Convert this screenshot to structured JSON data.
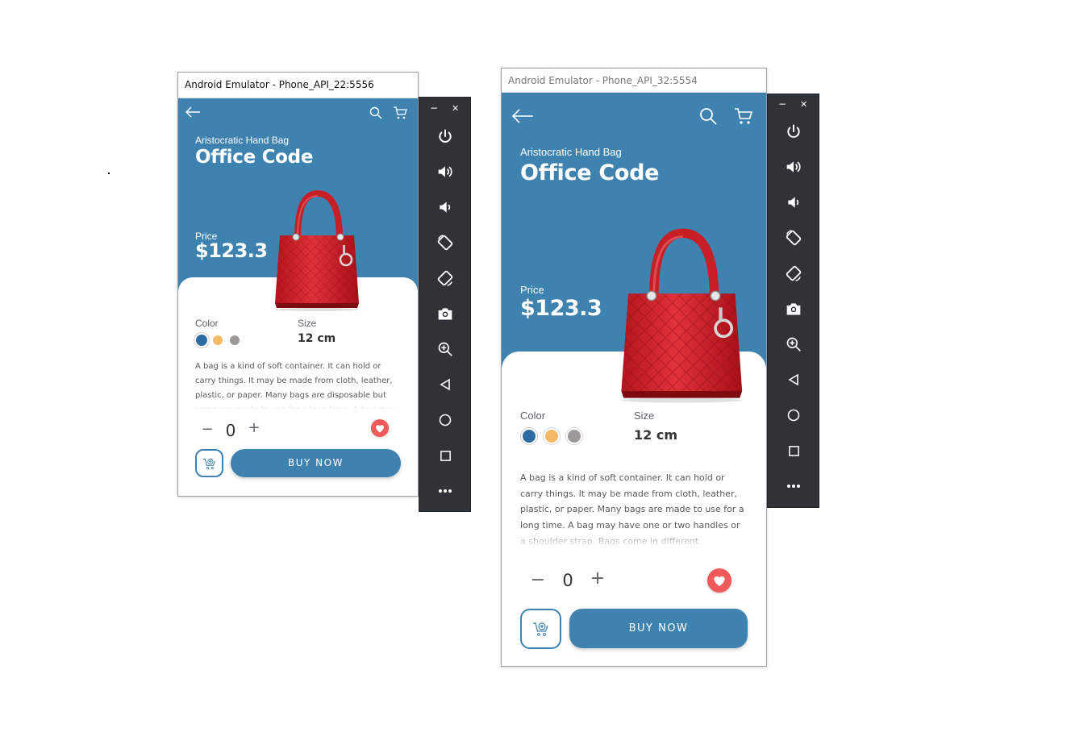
{
  "emulators": [
    {
      "window_title": "Android Emulator - Phone_API_22:5556",
      "app": {
        "subtitle": "Aristocratic Hand Bag",
        "title": "Office Code",
        "price_label": "Price",
        "price_value": "$123.3",
        "color_label": "Color",
        "size_label": "Size",
        "size_value": "12 cm",
        "description": "A bag is a kind of soft container. It can hold or carry things. It may be made from cloth, leather, plastic, or paper. Many bags are disposable but some are made to use for a long time. A bag may have one or two",
        "quantity_minus": "−",
        "quantity_value": "0",
        "quantity_plus": "+",
        "buy_label": "BUY NOW"
      }
    },
    {
      "window_title": "Android Emulator - Phone_API_32:5554",
      "app": {
        "subtitle": "Aristocratic Hand Bag",
        "title": "Office Code",
        "price_label": "Price",
        "price_value": "$123.3",
        "color_label": "Color",
        "size_label": "Size",
        "size_value": "12 cm",
        "description": "A bag is a kind of soft container. It can hold or carry things. It may be made from cloth, leather, plastic, or paper. Many bags are made to use for a long time. A bag may have one or two handles or a shoulder strap. Bags come in different",
        "quantity_minus": "−",
        "quantity_value": "0",
        "quantity_plus": "+",
        "buy_label": "BUY NOW"
      }
    }
  ],
  "sidebar_controls": {
    "minimize": "−",
    "close": "✕",
    "buttons": [
      "power-icon",
      "volume-up-icon",
      "volume-down-icon",
      "rotate-left-icon",
      "rotate-right-icon",
      "camera-icon",
      "zoom-icon",
      "back-icon",
      "home-icon",
      "overview-icon",
      "more-icon"
    ]
  },
  "colors": {
    "primary": "#3e82b0",
    "swatches": [
      "#2e6ca4",
      "#f5b863",
      "#9c999b"
    ],
    "heart": "#ef5a5a",
    "bag": "#d8242b",
    "sidebar": "#2f3338"
  }
}
